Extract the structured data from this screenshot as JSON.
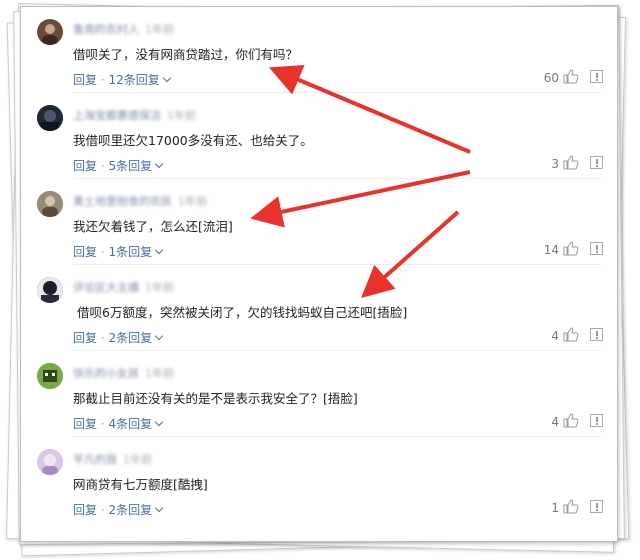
{
  "comments": [
    {
      "user": "鲁南的农村人",
      "meta": "1年前",
      "text": "借呗关了，没有网商贷踏过，你们有吗？",
      "reply_label": "回复",
      "replies": "12条回复",
      "likes": "60",
      "avatar_color": "#6b4a3a"
    },
    {
      "user": "上海宝都惠德保洁",
      "meta": "1年前",
      "text": "我借呗里还欠17000多没有还、也给关了。",
      "reply_label": "回复",
      "replies": "5条回复",
      "likes": "3",
      "avatar_color": "#1f2a36"
    },
    {
      "user": "黄土地里刨食的农民",
      "meta": "1年前",
      "text": "我还欠着钱了，怎么还[流泪]",
      "reply_label": "回复",
      "replies": "1条回复",
      "likes": "14",
      "avatar_color": "#8a7a6a"
    },
    {
      "user": "评论区大主播",
      "meta": "1年前",
      "text": "借呗6万额度，突然被关闭了，欠的钱找蚂蚁自己还吧[捂脸]",
      "reply_label": "回复",
      "replies": "2条回复",
      "likes": "4",
      "avatar_color": "#2a2a3a"
    },
    {
      "user": "快乐的小女孩",
      "meta": "1年前",
      "text": "那截止目前还没有关的是不是表示我安全了？[捂脸]",
      "reply_label": "回复",
      "replies": "4条回复",
      "likes": "4",
      "avatar_color": "#5e8c3a"
    },
    {
      "user": "平凡的我",
      "meta": "1年前",
      "text": "网商贷有七万额度[酷拽]",
      "reply_label": "回复",
      "replies": "2条回复",
      "likes": "1",
      "avatar_color": "#c9b8d8"
    }
  ],
  "dot": "·",
  "colors": {
    "link": "#4a6fa5",
    "arrow": "#e8322b",
    "text": "#222222"
  }
}
